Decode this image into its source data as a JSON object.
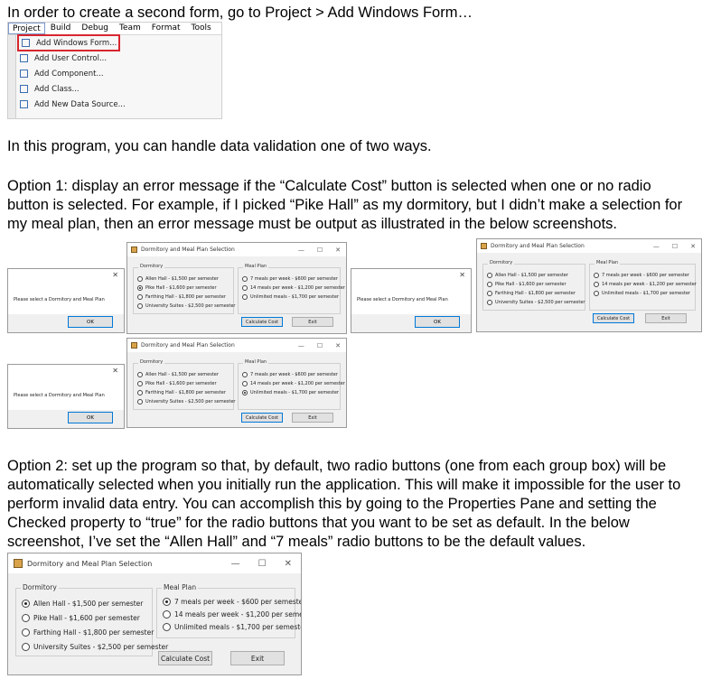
{
  "paragraphs": {
    "intro": "In order to create a second form, go to Project > Add Windows Form…",
    "p2": "In this program, you can handle data validation one of two ways.",
    "opt1_l1": "Option 1:  display an error message if the “Calculate Cost” button is selected when one or no radio",
    "opt1_l2": "button is selected.  For example, if I picked “Pike Hall” as my dormitory, but I didn’t make a selection for",
    "opt1_l3": "my meal plan, then an error message must be output as illustrated in the below screenshots.",
    "opt2_l1": "Option 2:  set up the program so that, by default, two radio buttons (one from each group box) will be",
    "opt2_l2": "automatically selected when you initially run the application.  This will make it impossible for the user to",
    "opt2_l3": "perform invalid data entry.  You can accomplish this by going to the Properties Pane and setting the",
    "opt2_l4": "Checked property to “true” for the radio buttons that you want to be set as default.  In the below",
    "opt2_l5": "screenshot, I’ve set the “Allen Hall” and “7 meals” radio buttons to be the default values."
  },
  "vs_menu": {
    "menubar": [
      "Project",
      "Build",
      "Debug",
      "Team",
      "Format",
      "Tools"
    ],
    "items": [
      "Add Windows Form...",
      "Add User Control...",
      "Add Component...",
      "Add Class...",
      "Add New Data Source..."
    ],
    "highlighted_item": "Add Windows Form..."
  },
  "form": {
    "title": "Dormitory and Meal Plan Selection",
    "dorm_group": "Dormitory",
    "meal_group": "Meal Plan",
    "dorms": [
      "Allen Hall - $1,500 per semester",
      "Pike Hall - $1,600 per semester",
      "Farthing Hall - $1,800 per semester",
      "University Suites - $2,500 per semester"
    ],
    "meals": [
      "7 meals per week - $600 per semester",
      "14 meals per week - $1,200 per semester",
      "Unlimited meals - $1,700 per semester"
    ],
    "calc_button": "Calculate Cost",
    "exit_button": "Exit",
    "min": "—",
    "max": "☐",
    "close": "✕"
  },
  "message_box": {
    "text": "Please select a Dormitory and Meal Plan",
    "ok": "OK",
    "close": "✕"
  }
}
